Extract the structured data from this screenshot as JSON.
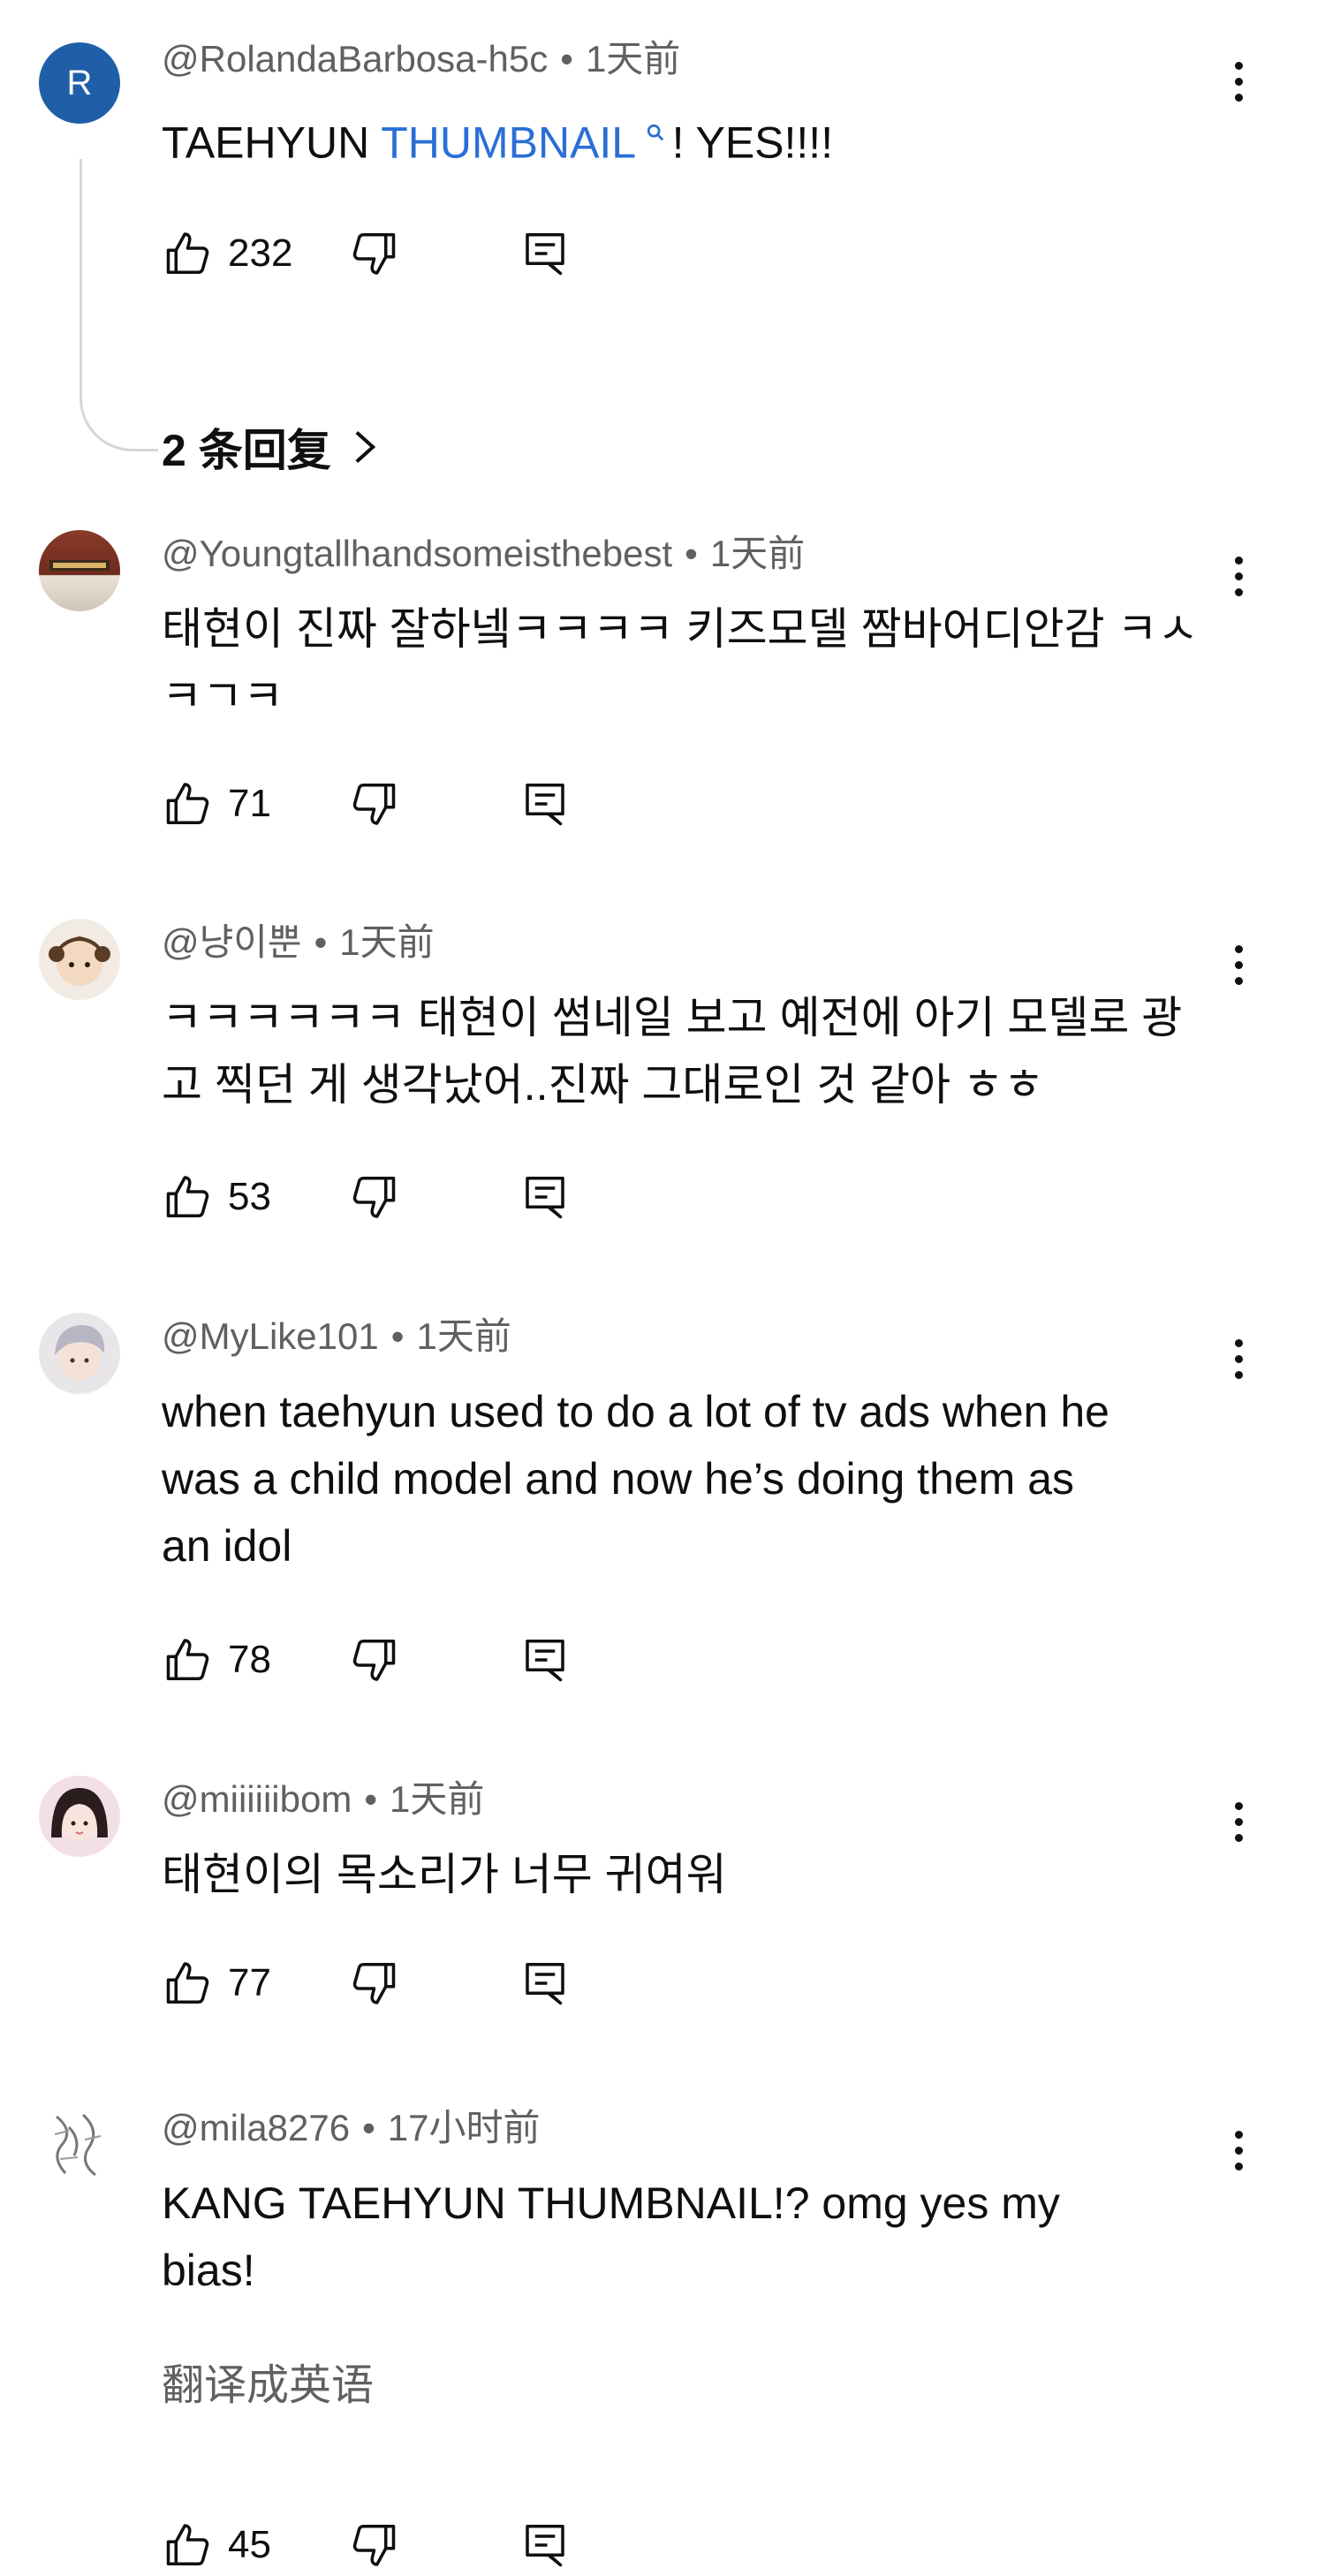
{
  "comments": [
    {
      "author": "@RolandaBarbosa-h5c",
      "time": "1天前",
      "avatar_letter": "R",
      "text_prefix": "TAEHYUN ",
      "text_link": "THUMBNAIL",
      "text_suffix": "! YES!!!!",
      "likes": "232",
      "replies_label": "2 条回复"
    },
    {
      "author": "@Youngtallhandsomeisthebest",
      "time": "1天前",
      "text_line1": "태현이 진짜 잘하넼ㅋㅋㅋㅋ 키즈모델 짬바어디안감 ㅋㅅ",
      "text_line2": "ㅋㄱㅋ",
      "likes": "71"
    },
    {
      "author": "@냥이뿐",
      "time": "1天前",
      "text_line1": "ㅋㅋㅋㅋㅋㅋ 태현이 썸네일 보고 예전에 아기 모델로 광",
      "text_line2": "고 찍던 게 생각났어..진짜 그대로인 것 같아 ㅎㅎ",
      "likes": "53"
    },
    {
      "author": "@MyLike101",
      "time": "1天前",
      "text_line1": "when taehyun used to do a lot of tv ads when he",
      "text_line2": "was a child model and now he’s doing them as",
      "text_line3": "an idol",
      "likes": "78"
    },
    {
      "author": "@miiiiiibom",
      "time": "1天前",
      "text_line1": "태현이의 목소리가 너무 귀여워",
      "likes": "77"
    },
    {
      "author": "@mila8276",
      "time": "17小时前",
      "text_line1": "KANG TAEHYUN THUMBNAIL!? omg yes my",
      "text_line2": "bias!",
      "translate_label": "翻译成英语",
      "likes": "45"
    }
  ],
  "colors": {
    "meta_text": "#606060",
    "link": "#2a6fd6",
    "avatar_r": "#1f5fa8"
  },
  "icons": [
    "like-icon",
    "dislike-icon",
    "reply-icon",
    "more-vert-icon",
    "chevron-right-icon",
    "search-icon"
  ]
}
